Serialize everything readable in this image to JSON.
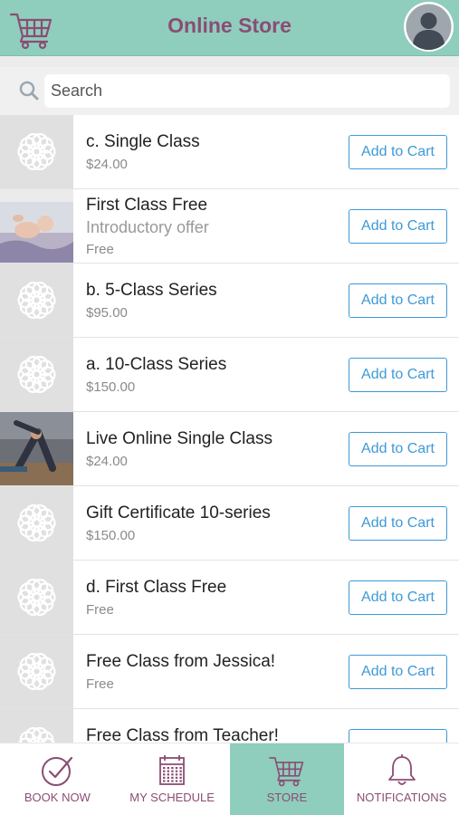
{
  "header": {
    "title": "Online Store",
    "cart_icon": "cart-icon",
    "avatar_icon": "avatar-icon"
  },
  "search": {
    "placeholder": "Search",
    "value": ""
  },
  "products": [
    {
      "name": "c. Single Class",
      "subtitle": "",
      "price": "$24.00",
      "thumb": "logo",
      "button": "Add to Cart"
    },
    {
      "name": "First Class Free",
      "subtitle": "Introductory offer",
      "price": "Free",
      "thumb": "photo-baby",
      "button": "Add to Cart"
    },
    {
      "name": "b. 5-Class Series",
      "subtitle": "",
      "price": "$95.00",
      "thumb": "logo",
      "button": "Add to Cart"
    },
    {
      "name": "a. 10-Class Series",
      "subtitle": "",
      "price": "$150.00",
      "thumb": "logo",
      "button": "Add to Cart"
    },
    {
      "name": "Live Online Single Class",
      "subtitle": "",
      "price": "$24.00",
      "thumb": "photo-yoga",
      "button": "Add to Cart"
    },
    {
      "name": "Gift Certificate 10-series",
      "subtitle": "",
      "price": "$150.00",
      "thumb": "logo",
      "button": "Add to Cart"
    },
    {
      "name": "d. First Class Free",
      "subtitle": "",
      "price": "Free",
      "thumb": "logo",
      "button": "Add to Cart"
    },
    {
      "name": "Free Class from Jessica!",
      "subtitle": "",
      "price": "Free",
      "thumb": "logo",
      "button": "Add to Cart"
    },
    {
      "name": "Free Class from Teacher!",
      "subtitle": "",
      "price": "",
      "thumb": "logo",
      "button": ""
    }
  ],
  "tabs": [
    {
      "label": "BOOK NOW",
      "icon": "check-circle-icon",
      "active": false
    },
    {
      "label": "MY SCHEDULE",
      "icon": "calendar-icon",
      "active": false
    },
    {
      "label": "STORE",
      "icon": "cart-icon",
      "active": true
    },
    {
      "label": "NOTIFICATIONS",
      "icon": "bell-icon",
      "active": false
    }
  ],
  "colors": {
    "header_bg": "#8fcdbd",
    "title": "#8a4d74",
    "button": "#3d9ad7",
    "tab_label": "#8a4d74"
  }
}
